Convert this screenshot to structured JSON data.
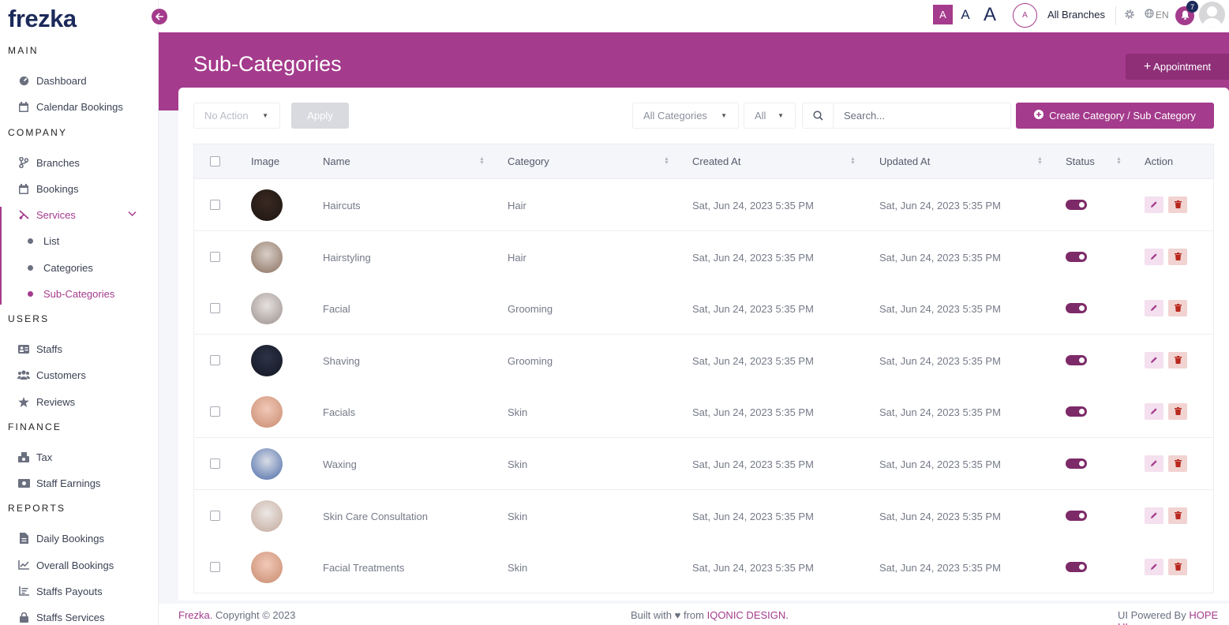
{
  "brand": {
    "logo": "frezka",
    "accent": "#a43b8c",
    "navy": "#1c2a5a"
  },
  "sidebar": {
    "sections": {
      "main": "MAIN",
      "company": "COMPANY",
      "users": "USERS",
      "finance": "FINANCE",
      "reports": "REPORTS"
    },
    "items": {
      "dashboard": "Dashboard",
      "calendar_bookings": "Calendar Bookings",
      "branches": "Branches",
      "bookings": "Bookings",
      "services": "Services",
      "services_list": "List",
      "services_categories": "Categories",
      "services_subcategories": "Sub-Categories",
      "staffs": "Staffs",
      "customers": "Customers",
      "reviews": "Reviews",
      "tax": "Tax",
      "staff_earnings": "Staff Earnings",
      "daily_bookings": "Daily Bookings",
      "overall_bookings": "Overall Bookings",
      "staffs_payouts": "Staffs Payouts",
      "staffs_services": "Staffs Services"
    }
  },
  "header": {
    "font_sizes": [
      "A",
      "A",
      "A"
    ],
    "branch_avatar": "A",
    "branch_label": "All Branches",
    "language": "EN",
    "notification_count": "7"
  },
  "page": {
    "title": "Sub-Categories",
    "appointment_button": "Appointment"
  },
  "toolbar": {
    "bulk_action": "No Action",
    "apply": "Apply",
    "category_filter": "All Categories",
    "status_filter": "All",
    "search_placeholder": "Search...",
    "create_button": "Create Category / Sub Category"
  },
  "table": {
    "columns": {
      "image": "Image",
      "name": "Name",
      "category": "Category",
      "created_at": "Created At",
      "updated_at": "Updated At",
      "status": "Status",
      "action": "Action"
    },
    "rows": [
      {
        "name": "Haircuts",
        "category": "Hair",
        "created_at": "Sat, Jun 24, 2023 5:35 PM",
        "updated_at": "Sat, Jun 24, 2023 5:35 PM",
        "status": "on"
      },
      {
        "name": "Hairstyling",
        "category": "Hair",
        "created_at": "Sat, Jun 24, 2023 5:35 PM",
        "updated_at": "Sat, Jun 24, 2023 5:35 PM",
        "status": "on"
      },
      {
        "name": "Facial",
        "category": "Grooming",
        "created_at": "Sat, Jun 24, 2023 5:35 PM",
        "updated_at": "Sat, Jun 24, 2023 5:35 PM",
        "status": "on"
      },
      {
        "name": "Shaving",
        "category": "Grooming",
        "created_at": "Sat, Jun 24, 2023 5:35 PM",
        "updated_at": "Sat, Jun 24, 2023 5:35 PM",
        "status": "on"
      },
      {
        "name": "Facials",
        "category": "Skin",
        "created_at": "Sat, Jun 24, 2023 5:35 PM",
        "updated_at": "Sat, Jun 24, 2023 5:35 PM",
        "status": "on"
      },
      {
        "name": "Waxing",
        "category": "Skin",
        "created_at": "Sat, Jun 24, 2023 5:35 PM",
        "updated_at": "Sat, Jun 24, 2023 5:35 PM",
        "status": "on"
      },
      {
        "name": "Skin Care Consultation",
        "category": "Skin",
        "created_at": "Sat, Jun 24, 2023 5:35 PM",
        "updated_at": "Sat, Jun 24, 2023 5:35 PM",
        "status": "on"
      },
      {
        "name": "Facial Treatments",
        "category": "Skin",
        "created_at": "Sat, Jun 24, 2023 5:35 PM",
        "updated_at": "Sat, Jun 24, 2023 5:35 PM",
        "status": "on"
      }
    ]
  },
  "footer": {
    "brand": "Frezka.",
    "copyright": "Copyright © 2023",
    "built_with": "Built with ♥ from",
    "built_by": "IQONIC DESIGN.",
    "ui_powered": "UI Powered By",
    "ui_by": "HOPE UI"
  }
}
